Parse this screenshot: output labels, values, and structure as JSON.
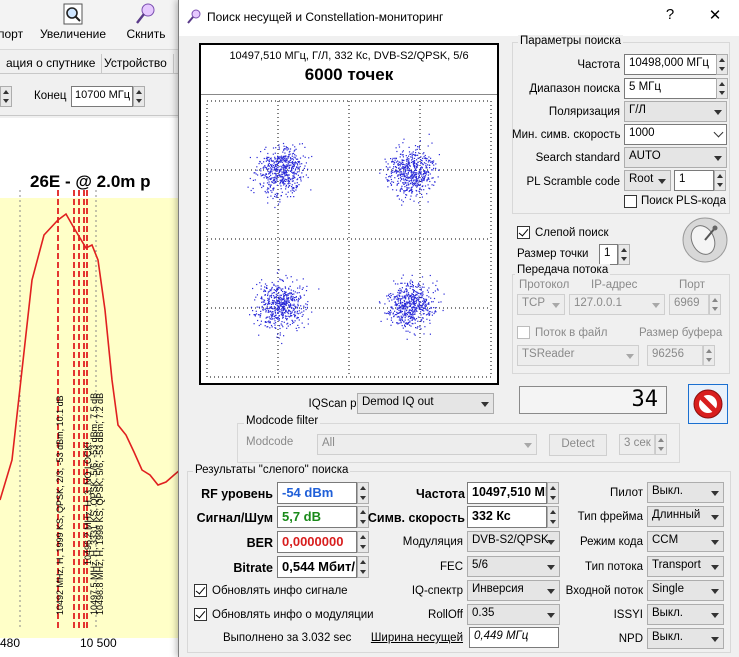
{
  "background_app": {
    "toolbar": {
      "export_label": "порт",
      "zoom_label": "Увеличение",
      "scan_label": "Скнить"
    },
    "tabs": [
      "ация о спутнике",
      "Устройство"
    ],
    "range": {
      "end_label": "Конец",
      "end_value": "10700 МГц"
    },
    "plot": {
      "title": "26E -  @ 2.0m p",
      "x_ticks": [
        "480",
        "10 500"
      ],
      "marker_labels": [
        "10492 MHz, H, 1999 KS, QPSK, 2/3, -53 dBm, 10.1 dB",
        "10496.2 MHz, H, 3, NO LOCK!",
        "10497.5 MHz, H, 3331 KS, QPSK, 5/6, -53 dBm, 7.5 dB",
        "10498.8 MHz, H, 1998 KS, QPSK, 5/6, -53 dBm, 7.2 dB"
      ]
    }
  },
  "dialog": {
    "title": "Поиск несущей и Constellation-мониторинг",
    "help_btn": "?",
    "close_btn": "✕",
    "constellation": {
      "info_line": "10497,510 МГц, Г/Л, 332 Кс, DVB-S2/QPSK, 5/6",
      "points_label": "6000 точек"
    },
    "search_params": {
      "group_title": "Параметры поиска",
      "frequency": {
        "label": "Частота",
        "value": "10498,000 МГц"
      },
      "search_range": {
        "label": "Диапазон поиска",
        "value": "5 МГц"
      },
      "polarization": {
        "label": "Поляризация",
        "value": "Г/Л"
      },
      "min_symbol_rate": {
        "label": "Мин. симв. скорость",
        "value": "1000"
      },
      "search_standard": {
        "label": "Search standard",
        "value": "AUTO"
      },
      "pl_scramble": {
        "label": "PL Scramble code",
        "mode": "Root",
        "value": "1"
      },
      "pls_search": {
        "label": "Поиск PLS-кода",
        "checked": false
      }
    },
    "blind_search": {
      "label": "Слепой поиск",
      "checked": true
    },
    "point_size": {
      "label": "Размер точки",
      "value": "1"
    },
    "stream": {
      "group_title": "Передача потока",
      "protocol_label": "Протокол",
      "protocol_value": "TCP",
      "ip_label": "IP-адрес",
      "ip_value": "127.0.0.1",
      "port_label": "Порт",
      "port_value": "6969",
      "file_stream_label": "Поток в файл",
      "file_stream_checked": false,
      "buffer_label": "Размер буфера",
      "app_value": "TSReader",
      "buffer_value": "96256"
    },
    "counter_value": "34",
    "iqscan": {
      "label": "IQScan point",
      "value": "Demod IQ out"
    },
    "modcode_filter": {
      "group_title": "Modcode filter",
      "modcode_label": "Modcode",
      "modcode_value": "All",
      "detect_btn": "Detect",
      "interval_value": "3 сек"
    },
    "results": {
      "group_title": "Результаты \"слепого\" поиска",
      "rf_level": {
        "label": "RF уровень",
        "value": "-54 dBm"
      },
      "snr": {
        "label": "Сигнал/Шум",
        "value": "5,7 dB"
      },
      "ber": {
        "label": "BER",
        "value": "0,0000000"
      },
      "bitrate": {
        "label": "Bitrate",
        "value": "0,544 Мбит/"
      },
      "frequency": {
        "label": "Частота",
        "value": "10497,510 МГ"
      },
      "symbol_rate": {
        "label": "Симв. скорость",
        "value": "332 Кс"
      },
      "modulation": {
        "label": "Модуляция",
        "value": "DVB-S2/QPSK"
      },
      "fec": {
        "label": "FEC",
        "value": "5/6"
      },
      "iq_spectrum": {
        "label": "IQ-спектр",
        "value": "Инверсия"
      },
      "rolloff": {
        "label": "RollOff",
        "value": "0.35"
      },
      "pilot": {
        "label": "Пилот",
        "value": "Выкл."
      },
      "frame_type": {
        "label": "Тип фрейма",
        "value": "Длинный"
      },
      "code_mode": {
        "label": "Режим кода",
        "value": "CCM"
      },
      "stream_type": {
        "label": "Тип потока",
        "value": "Transport"
      },
      "input_stream": {
        "label": "Входной поток",
        "value": "Single"
      },
      "issyi": {
        "label": "ISSYI",
        "value": "Выкл."
      },
      "npd": {
        "label": "NPD",
        "value": "Выкл."
      },
      "update_signal": {
        "label": "Обновлять инфо сигнале",
        "checked": true
      },
      "update_modulation": {
        "label": "Обновлять инфо о модуляции",
        "checked": true
      },
      "elapsed": "Выполнено за 3.032 sec",
      "bandwidth_label": "Ширина несущей",
      "bandwidth_value": "0,449 МГц"
    },
    "colors": {
      "constellation_points": "#2a2ad8",
      "rf_value": "#1f5fd8",
      "snr_value": "#1a8a1a",
      "ber_value": "#d81e1e",
      "marker_lines": "#e02020"
    }
  }
}
